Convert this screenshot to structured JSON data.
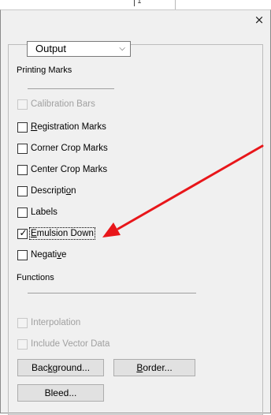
{
  "ruler": {
    "text": "1"
  },
  "dialog": {
    "close_glyph": "×",
    "dropdown": {
      "value": "Output",
      "chevron": "⌵"
    },
    "printing_marks": {
      "heading": "Printing Marks",
      "items": [
        {
          "pre": "",
          "u": "",
          "post": "Calibration Bars",
          "checked": false,
          "disabled": true
        },
        {
          "pre": "",
          "u": "R",
          "post": "egistration Marks",
          "checked": false,
          "disabled": false
        },
        {
          "pre": "Corner Crop Marks",
          "u": "",
          "post": "",
          "checked": false,
          "disabled": false
        },
        {
          "pre": "Center Crop Marks",
          "u": "",
          "post": "",
          "checked": false,
          "disabled": false
        },
        {
          "pre": "Descripti",
          "u": "o",
          "post": "n",
          "checked": false,
          "disabled": false
        },
        {
          "pre": "Labels",
          "u": "",
          "post": "",
          "checked": false,
          "disabled": false
        },
        {
          "pre": "",
          "u": "E",
          "post": "mulsion Down",
          "checked": true,
          "disabled": false,
          "focused": true
        },
        {
          "pre": "Negati",
          "u": "v",
          "post": "e",
          "checked": false,
          "disabled": false
        }
      ]
    },
    "functions": {
      "heading": "Functions",
      "items": [
        {
          "label": "Interpolation",
          "checked": false,
          "disabled": true
        },
        {
          "label": "Include Vector Data",
          "checked": false,
          "disabled": true
        }
      ]
    },
    "buttons": {
      "background": {
        "pre": "Bac",
        "u": "k",
        "post": "ground..."
      },
      "border": {
        "pre": "",
        "u": "B",
        "post": "order..."
      },
      "bleed": {
        "label": "Bleed..."
      }
    },
    "check_glyph": "✓"
  },
  "annotation": {
    "arrow_color": "#e8161a"
  }
}
